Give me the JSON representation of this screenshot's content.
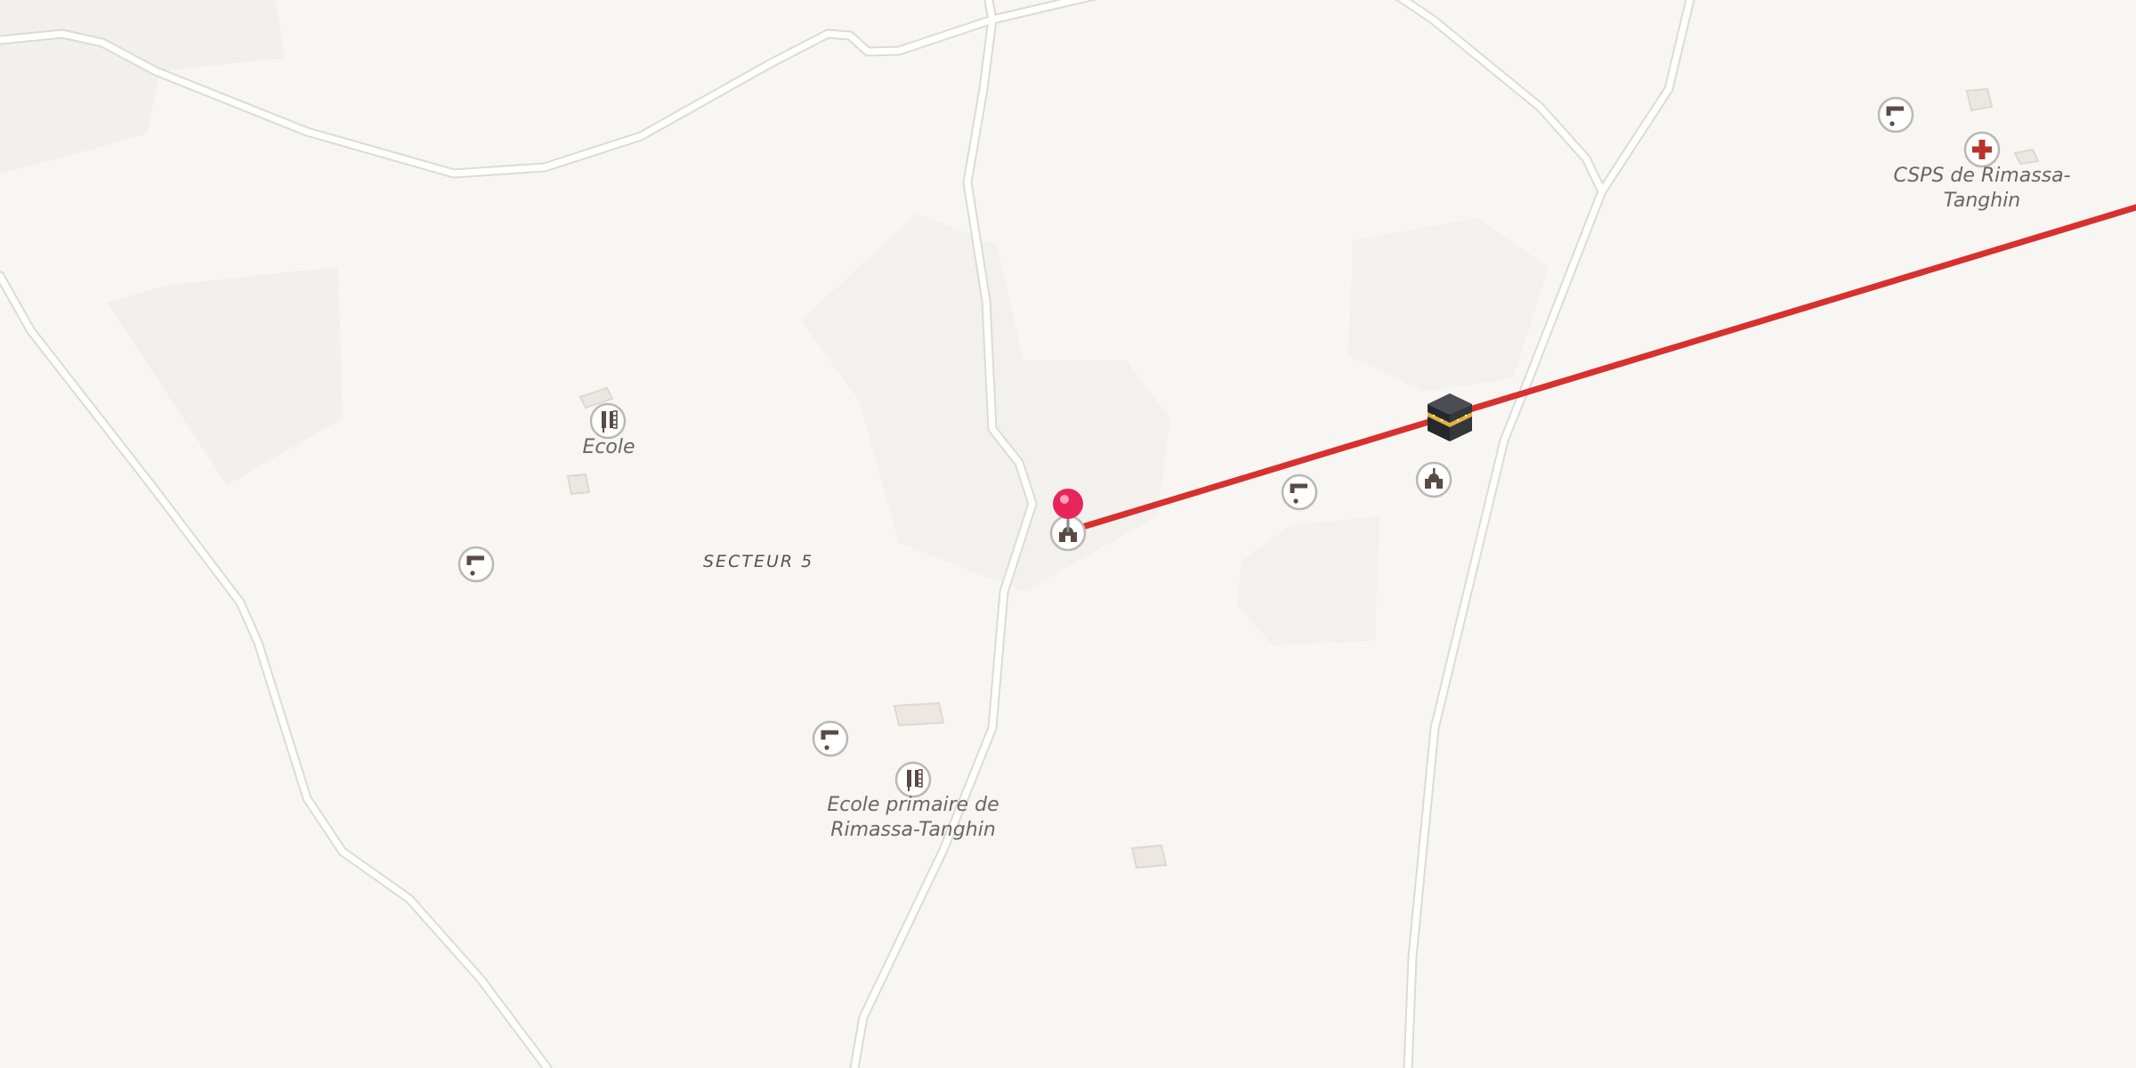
{
  "map": {
    "labels": {
      "ecole": "Ecole",
      "sector": "SECTEUR 5",
      "school_primary_line1": "Ecole primaire de",
      "school_primary_line2": "Rimassa-Tanghin",
      "health_line1": "CSPS de Rimassa-",
      "health_line2": "Tanghin"
    },
    "route_color": "#d8302f",
    "pin_color": "#e8245a",
    "poi_icons": [
      "school-icon",
      "water-tap-icon",
      "mosque-icon",
      "kaaba-icon",
      "hospital-icon",
      "location-pin-icon"
    ]
  }
}
